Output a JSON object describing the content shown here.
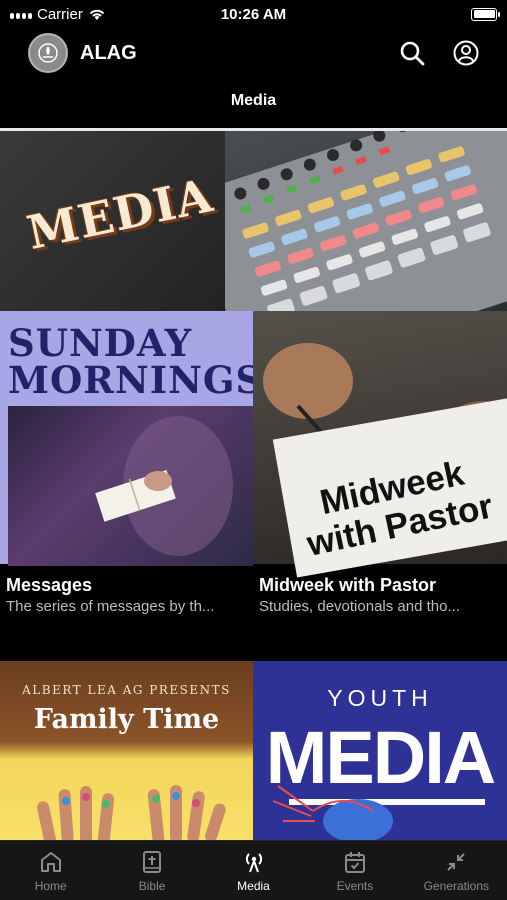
{
  "status_bar": {
    "carrier": "Carrier",
    "time": "10:26 AM"
  },
  "header": {
    "app_name": "ALAG"
  },
  "nav": {
    "title": "Media"
  },
  "hero": {
    "word": "MEDIA"
  },
  "tiles": [
    {
      "art_lines": [
        "SUNDAY",
        "MORNINGS"
      ],
      "title": "Messages",
      "subtitle": "The series of messages by th..."
    },
    {
      "art_lines": [
        "Midweek",
        "with Pastor"
      ],
      "title": "Midweek with Pastor",
      "subtitle": "Studies, devotionals and tho..."
    },
    {
      "art_lines": [
        "ALBERT LEA AG PRESENTS",
        "Family Time"
      ]
    },
    {
      "art_lines": [
        "YOUTH",
        "MEDIA"
      ]
    }
  ],
  "tab_bar": {
    "active": "Media",
    "tabs": [
      {
        "label": "Home",
        "icon": "home-icon"
      },
      {
        "label": "Bible",
        "icon": "bible-icon"
      },
      {
        "label": "Media",
        "icon": "broadcast-icon"
      },
      {
        "label": "Events",
        "icon": "calendar-icon"
      },
      {
        "label": "Generations",
        "icon": "collapse-arrows-icon"
      }
    ]
  },
  "colors": {
    "background": "#000000",
    "tab_bar": "#161616",
    "inactive": "#8a8a8a",
    "sunday_bg": "#a9a6e6",
    "sunday_text": "#22226b",
    "youth_bg": "#2e3195"
  }
}
